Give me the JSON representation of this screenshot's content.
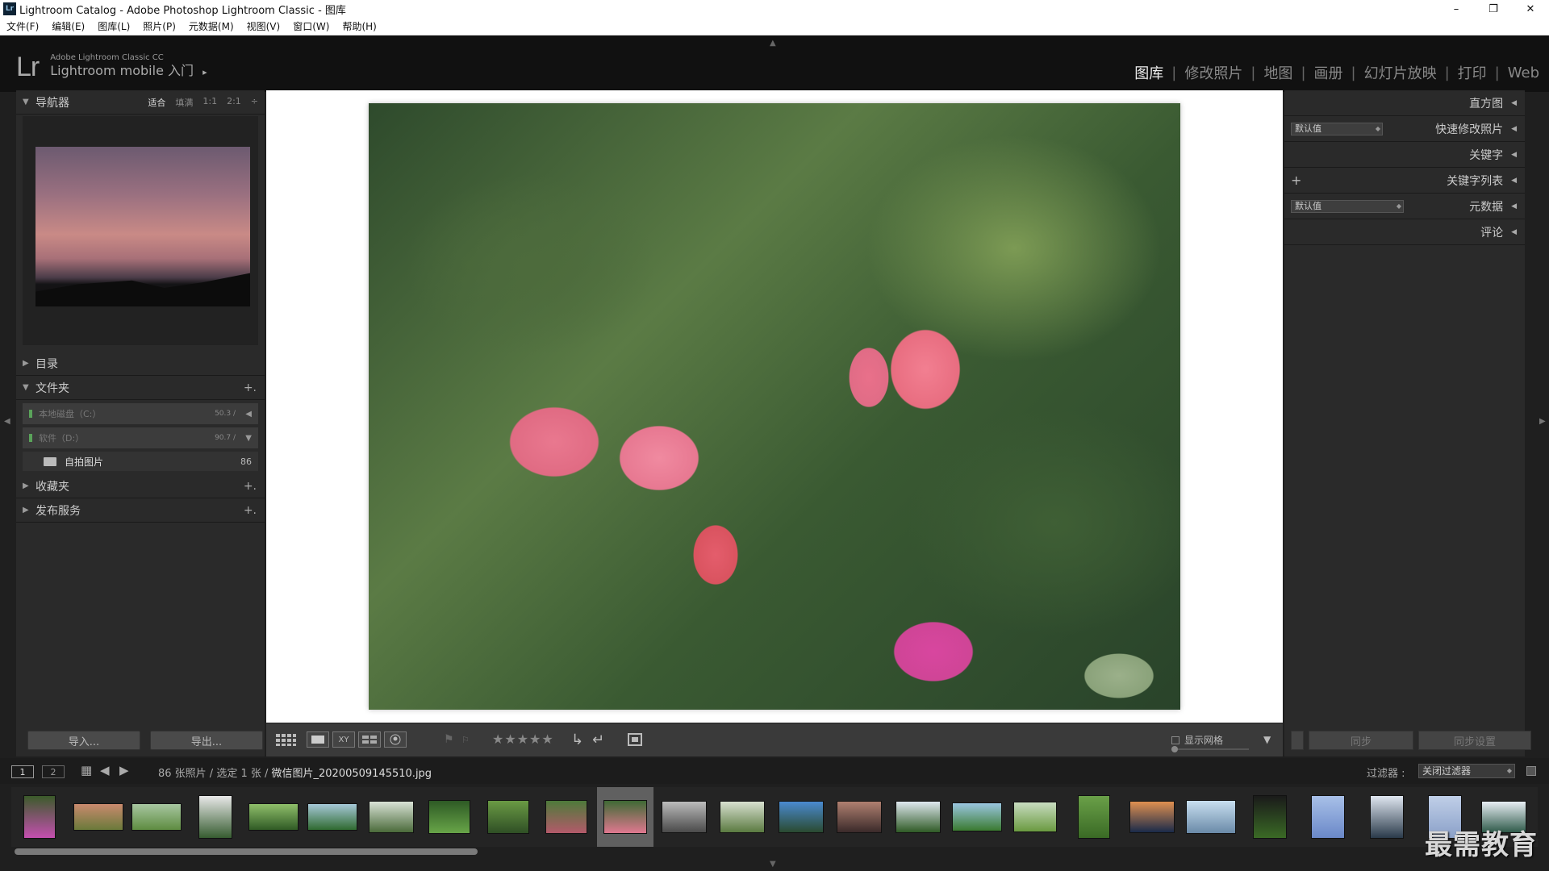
{
  "window": {
    "title": "Lightroom Catalog - Adobe Photoshop Lightroom Classic - 图库",
    "app_icon_label": "Lr",
    "minimize": "–",
    "restore": "❐",
    "close": "✕"
  },
  "menu": [
    "文件(F)",
    "编辑(E)",
    "图库(L)",
    "照片(P)",
    "元数据(M)",
    "视图(V)",
    "窗口(W)",
    "帮助(H)"
  ],
  "identity": {
    "logo": "Lr",
    "subtitle": "Adobe Lightroom Classic CC",
    "mobile": "Lightroom mobile 入门",
    "mobile_arrow": "▸"
  },
  "modules": {
    "library": "图库",
    "develop": "修改照片",
    "map": "地图",
    "book": "画册",
    "slideshow": "幻灯片放映",
    "print": "打印",
    "web": "Web",
    "separator": "|"
  },
  "left_panel": {
    "navigator": {
      "title": "导航器",
      "fit": "适合",
      "fill": "填满",
      "one": "1:1",
      "two": "2:1",
      "more": "÷"
    },
    "catalog": "目录",
    "folders": {
      "title": "文件夹",
      "add": "+.",
      "drive1_name": "本地磁盘（C:）",
      "drive1_val": "50.3 /",
      "drive2_name": "软件（D:）",
      "drive2_val": "90.7 /",
      "folder_name": "自拍图片",
      "folder_count": "86"
    },
    "collections": "收藏夹",
    "publish": "发布服务",
    "import_btn": "导入...",
    "export_btn": "导出..."
  },
  "toolbar": {
    "stars": "★★★★★",
    "show_grid": "显示网格"
  },
  "right_panel": {
    "histogram": "直方图",
    "quick_develop": "快速修改照片",
    "quick_preset": "默认值",
    "keywording": "关键字",
    "keyword_list": "关键字列表",
    "metadata": "元数据",
    "metadata_preset": "默认值",
    "comments": "评论",
    "sync": "同步",
    "sync_settings": "同步设置"
  },
  "filmstrip_bar": {
    "page1": "1",
    "page2": "2",
    "count_info": "86 张照片 / 选定 1 张 /",
    "filename": "微信图片_20200509145510.jpg",
    "filter_label": "过滤器 :",
    "filter_value": "关闭过滤器"
  },
  "watermark": "最需教育",
  "filmstrip": [
    {
      "c1": "#3b5b2a",
      "c2": "#c54fb0",
      "w": 40,
      "h": 54
    },
    {
      "c1": "#c98a6e",
      "c2": "#6a7a3a",
      "w": 62,
      "h": 34
    },
    {
      "c1": "#a7c6a0",
      "c2": "#5e8c40",
      "w": 62,
      "h": 34
    },
    {
      "c1": "#e8e8e8",
      "c2": "#365c30",
      "w": 42,
      "h": 54
    },
    {
      "c1": "#8fbf6a",
      "c2": "#2f5a25",
      "w": 62,
      "h": 34
    },
    {
      "c1": "#a6c8d8",
      "c2": "#2f6a30",
      "w": 62,
      "h": 34
    },
    {
      "c1": "#d9e2d6",
      "c2": "#4a6a3a",
      "w": 56,
      "h": 40
    },
    {
      "c1": "#2e5a25",
      "c2": "#68a548",
      "w": 52,
      "h": 42
    },
    {
      "c1": "#6a9a44",
      "c2": "#2f4f25",
      "w": 52,
      "h": 42
    },
    {
      "c1": "#4e7a3a",
      "c2": "#b35a6a",
      "w": 52,
      "h": 42
    },
    {
      "c1": "#3f6a35",
      "c2": "#e07890",
      "w": 54,
      "h": 42
    },
    {
      "c1": "#bbbbbb",
      "c2": "#4a4a4a",
      "w": 56,
      "h": 40
    },
    {
      "c1": "#d8e0d0",
      "c2": "#5a7a40",
      "w": 56,
      "h": 40
    },
    {
      "c1": "#4a8ad0",
      "c2": "#2a4a30",
      "w": 56,
      "h": 40
    },
    {
      "c1": "#b08070",
      "c2": "#3a2a2a",
      "w": 56,
      "h": 40
    },
    {
      "c1": "#dfe8f0",
      "c2": "#2f5a25",
      "w": 56,
      "h": 40
    },
    {
      "c1": "#9ac6e0",
      "c2": "#3a7a30",
      "w": 62,
      "h": 36
    },
    {
      "c1": "#c8dcc0",
      "c2": "#6a9a40",
      "w": 54,
      "h": 38
    },
    {
      "c1": "#6aa048",
      "c2": "#3a6a25",
      "w": 40,
      "h": 54
    },
    {
      "c1": "#e09050",
      "c2": "#1a2a4a",
      "w": 56,
      "h": 40
    },
    {
      "c1": "#c8dff0",
      "c2": "#6a8aa8",
      "w": 62,
      "h": 42
    },
    {
      "c1": "#1a1a1a",
      "c2": "#3a6a25",
      "w": 42,
      "h": 54
    },
    {
      "c1": "#a8c0e8",
      "c2": "#6a88c8",
      "w": 42,
      "h": 54
    },
    {
      "c1": "#dfe6f0",
      "c2": "#2a3a4a",
      "w": 42,
      "h": 54
    },
    {
      "c1": "#c0cfe8",
      "c2": "#8aa0c8",
      "w": 42,
      "h": 54
    },
    {
      "c1": "#e8eef4",
      "c2": "#2f5a4a",
      "w": 56,
      "h": 40
    }
  ]
}
